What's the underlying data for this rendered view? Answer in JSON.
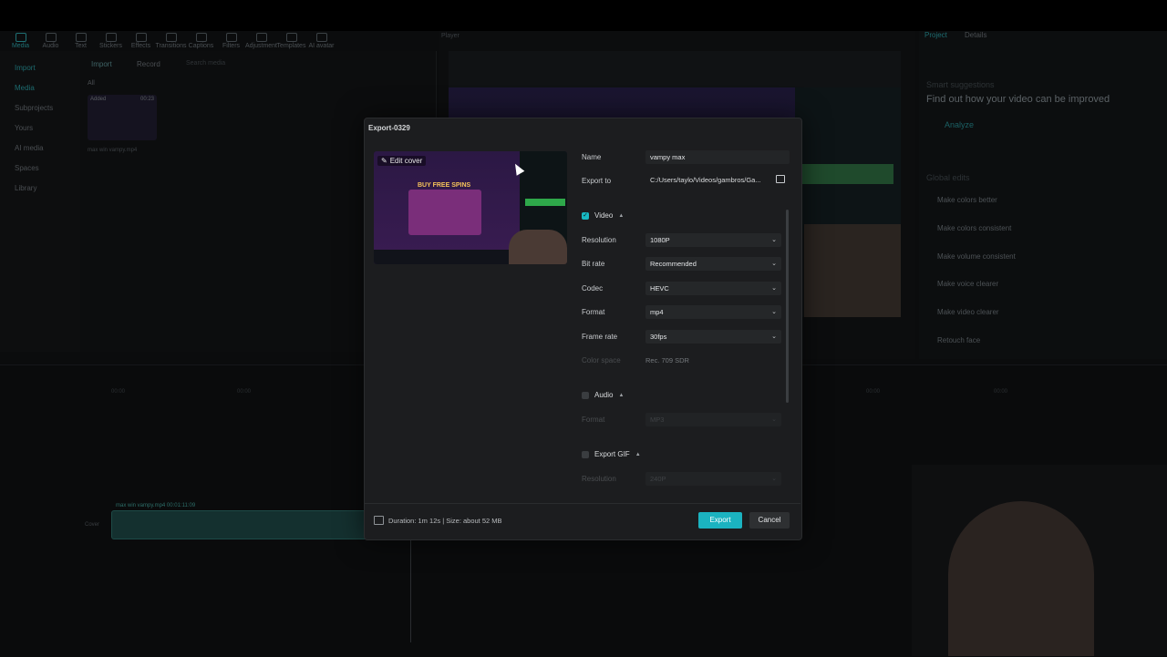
{
  "background_app": {
    "toolbar": [
      "Media",
      "Audio",
      "Text",
      "Stickers",
      "Effects",
      "Transitions",
      "Captions",
      "Filters",
      "Adjustment",
      "Templates",
      "AI avatar"
    ],
    "left_nav": [
      "Import",
      "Media",
      "Subprojects",
      "Yours",
      "AI media",
      "Spaces",
      "Library"
    ],
    "media_tabs": {
      "import": "Import",
      "record": "Record",
      "search_placeholder": "Search media",
      "all": "All"
    },
    "media_item": {
      "badge": "Added",
      "duration": "00:23",
      "filename": "max win vampy.mp4"
    },
    "player_label": "Player",
    "right_tabs": {
      "project": "Project",
      "details": "Details"
    },
    "smart_suggestions": {
      "title": "Smart suggestions",
      "subtitle": "Find out how your video can be improved",
      "analyze": "Analyze"
    },
    "global_edits": {
      "title": "Global edits",
      "items": [
        "Make colors better",
        "Make colors consistent",
        "Make volume consistent",
        "Make voice clearer",
        "Make video clearer",
        "Retouch face"
      ]
    },
    "timeline": {
      "clip_label": "max win vampy.mp4  00:01:11:09",
      "cover_label": "Cover",
      "time_marks": [
        "00:00",
        "00:00",
        "00:00",
        "00:00"
      ]
    }
  },
  "dialog": {
    "title": "Export-0329",
    "edit_cover": "Edit cover",
    "name_label": "Name",
    "name_value": "vampy max",
    "export_to_label": "Export to",
    "export_to_value": "C:/Users/taylo/Videos/gambros/Ga...",
    "video_section": "Video",
    "fields": [
      {
        "label": "Resolution",
        "value": "1080P"
      },
      {
        "label": "Bit rate",
        "value": "Recommended"
      },
      {
        "label": "Codec",
        "value": "HEVC"
      },
      {
        "label": "Format",
        "value": "mp4"
      },
      {
        "label": "Frame rate",
        "value": "30fps"
      }
    ],
    "color_space_label": "Color space",
    "color_space_value": "Rec. 709 SDR",
    "audio_section": "Audio",
    "audio_format_label": "Format",
    "audio_format_value": "MP3",
    "gif_section": "Export GIF",
    "gif_resolution_label": "Resolution",
    "gif_resolution_value": "240P",
    "footer_info": "Duration: 1m 12s | Size: about 52 MB",
    "export_button": "Export",
    "cancel_button": "Cancel",
    "cover_text": "BUY FREE SPINS"
  },
  "colors": {
    "accent": "#1bb3c0",
    "dialog_bg": "#1c1d1f"
  }
}
